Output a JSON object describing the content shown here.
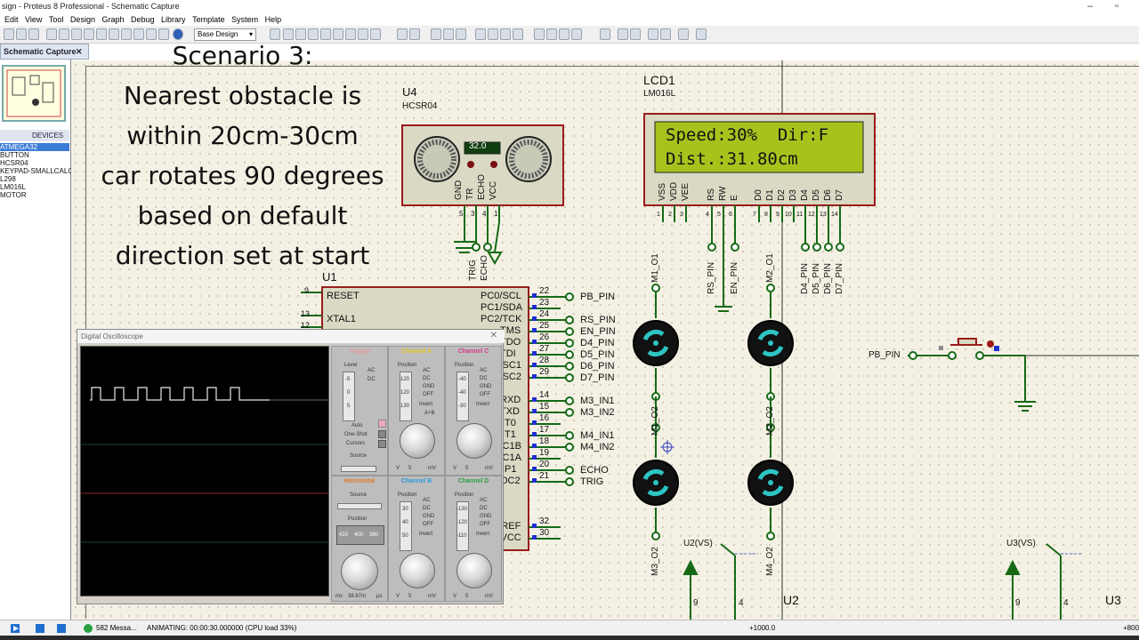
{
  "window": {
    "title": "sign - Proteus 8 Professional - Schematic Capture"
  },
  "menu": [
    "Edit",
    "View",
    "Tool",
    "Design",
    "Graph",
    "Debug",
    "Library",
    "Template",
    "System",
    "Help"
  ],
  "toolbar": {
    "design_select": "Base Design"
  },
  "tab": {
    "label": "Schematic Capture"
  },
  "devices": {
    "header": "DEVICES",
    "badge_p": "P",
    "badge_l": "L",
    "items": [
      "ATMEGA32",
      "BUTTON",
      "HCSR04",
      "KEYPAD-SMALLCALC",
      "L298",
      "LM016L",
      "MOTOR"
    ],
    "selected_index": 0
  },
  "scenario": {
    "lines": [
      "Scenario 3:",
      "Nearest obstacle is",
      "within 20cm-30cm",
      "car rotates 90 degrees",
      "based on default",
      "direction set at start"
    ]
  },
  "lcd": {
    "ref": "LCD1",
    "part": "LM016L",
    "row1": "Speed:30%  Dir:F",
    "row2": "Dist.:31.80cm",
    "pins": [
      "VSS",
      "VDD",
      "VEE",
      "RS",
      "RW",
      "E",
      "D0",
      "D1",
      "D2",
      "D3",
      "D4",
      "D5",
      "D6",
      "D7"
    ],
    "pin_numbers": [
      "1",
      "2",
      "3",
      "4",
      "5",
      "6",
      "7",
      "8",
      "9",
      "10",
      "11",
      "12",
      "13",
      "14"
    ]
  },
  "sonar": {
    "ref": "U4",
    "part": "HCSR04",
    "reading": "32.0",
    "pins": [
      "GND",
      "TR",
      "ECHO",
      "VCC"
    ],
    "pin_numbers": [
      "5",
      "3",
      "4",
      "1"
    ],
    "net_labels": [
      "TRIG",
      "ECHO"
    ]
  },
  "mcu": {
    "ref": "U1",
    "left_pins": [
      {
        "num": "9",
        "name": "RESET"
      },
      {
        "num": "13",
        "name": "XTAL1"
      },
      {
        "num": "12",
        "name": ""
      }
    ],
    "right_pins": [
      {
        "name": "PC0/SCL",
        "num": "22",
        "net": "PB_PIN"
      },
      {
        "name": "PC1/SDA",
        "num": "23",
        "net": ""
      },
      {
        "name": "PC2/TCK",
        "num": "24",
        "net": "RS_PIN"
      },
      {
        "name": "TMS",
        "num": "25",
        "net": "EN_PIN"
      },
      {
        "name": "TDO",
        "num": "26",
        "net": "D4_PIN"
      },
      {
        "name": "TDI",
        "num": "27",
        "net": "D5_PIN"
      },
      {
        "name": "OSC1",
        "num": "28",
        "net": "D6_PIN"
      },
      {
        "name": "OSC2",
        "num": "29",
        "net": "D7_PIN"
      },
      {
        "name": "RXD",
        "num": "14",
        "net": "M3_IN1"
      },
      {
        "name": "TXD",
        "num": "15",
        "net": "M3_IN2"
      },
      {
        "name": "INT0",
        "num": "16",
        "net": ""
      },
      {
        "name": "INT1",
        "num": "17",
        "net": "M4_IN1"
      },
      {
        "name": "OC1B",
        "num": "18",
        "net": "M4_IN2"
      },
      {
        "name": "OC1A",
        "num": "19",
        "net": ""
      },
      {
        "name": "ICP1",
        "num": "20",
        "net": "ECHO"
      },
      {
        "name": "OC2",
        "num": "21",
        "net": "TRIG"
      },
      {
        "name": "AREF",
        "num": "32",
        "net": ""
      },
      {
        "name": "AVCC",
        "num": "30",
        "net": ""
      }
    ]
  },
  "nets": {
    "lcd_side": [
      "RS_PIN",
      "EN_PIN",
      "D4_PIN",
      "D5_PIN",
      "D6_PIN",
      "D7_PIN"
    ],
    "motors": [
      "M1_O1",
      "M2_O1",
      "M1_O2",
      "M2_O2",
      "M3_O2",
      "M4_O2"
    ],
    "pb_left": "PB_PIN",
    "u2_vs": "U2(VS)",
    "u3_vs": "U3(VS)",
    "u2": "U2",
    "u3": "U3",
    "pin9": "9",
    "pin4": "4"
  },
  "oscilloscope": {
    "title": "Digital Oscilloscope",
    "trigger_label": "Trigger",
    "channel_a": "Channel A",
    "channel_b": "Channel B",
    "channel_c": "Channel C",
    "channel_d": "Channel D",
    "horizontal": "Horizontal",
    "level": "Level",
    "position": "Position",
    "source": "Source",
    "auto": "Auto",
    "one_shot": "One-Shot",
    "cursors": "Cursors",
    "coupling": [
      "AC",
      "DC",
      "GND",
      "OFF",
      "Invert"
    ],
    "a_plus_b": "A+B",
    "pos_a": [
      "120",
      "120",
      "130"
    ],
    "pos_c": [
      "-40",
      "-40",
      "-30"
    ],
    "pos_b": [
      "30",
      "40",
      "50"
    ],
    "pos_d": [
      "-130",
      "-120",
      "-110"
    ],
    "trig_level": [
      "-5",
      "0",
      "5"
    ],
    "h_position": [
      "410",
      "400",
      "390"
    ],
    "v_unit": "V",
    "mv_unit": "mV",
    "ms_unit": "ms",
    "us_unit": "μs",
    "time_readout": "38.67m",
    "knob_value": "5",
    "trace_color": "#e8e8e8",
    "grid_color": "#2f7f7f",
    "ref_line_color": "#b33"
  },
  "status": {
    "messages": "582 Messa...",
    "state": "ANIMATING: 00:00:30.000000 (CPU load 33%)",
    "coord": "+1000.0",
    "coord_right": "+800"
  },
  "colors": {
    "canvas": "#f4f1e4",
    "component_border": "#9b1b1b",
    "component_fill": "#d9d9c4",
    "wire": "#166a16",
    "lcd_screen": "#a8c21c",
    "accent": "#3b7bd6"
  }
}
